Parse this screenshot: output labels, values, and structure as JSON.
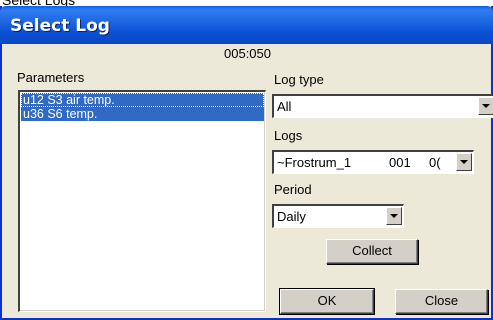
{
  "outer": {
    "partial_title": "Select Logs"
  },
  "window": {
    "title": "Select Log"
  },
  "header": {
    "time_readout": "005:050"
  },
  "parameters": {
    "label": "Parameters",
    "items": [
      {
        "label": "u12 S3 air temp."
      },
      {
        "label": "u36 S6 temp."
      }
    ]
  },
  "log_type": {
    "label": "Log type",
    "value": "All"
  },
  "logs": {
    "label": "Logs",
    "name": "~Frostrum_1",
    "col2": "001",
    "col3": "0("
  },
  "period": {
    "label": "Period",
    "value": "Daily"
  },
  "buttons": {
    "collect": "Collect",
    "ok": "OK",
    "close": "Close"
  },
  "colors": {
    "title_bar": "#0a55d6",
    "selection": "#316ac5",
    "dialog_face": "#ece9d8"
  },
  "icons": [
    "dropdown-arrow-icon"
  ]
}
